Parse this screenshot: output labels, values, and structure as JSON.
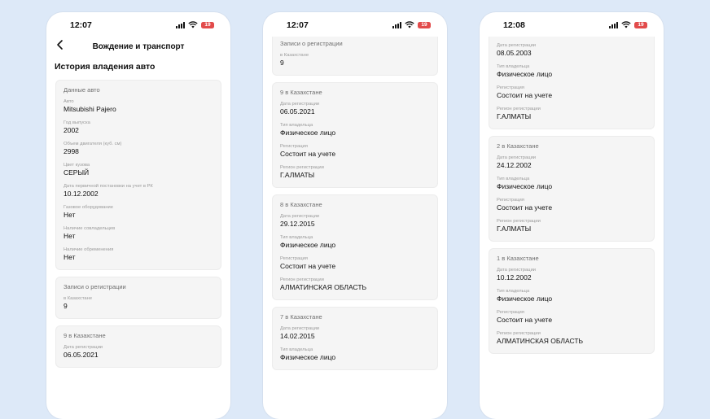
{
  "status": {
    "time1": "12:07",
    "time2": "12:07",
    "time3": "12:08",
    "battery": "19",
    "battery_color": "#e24b4b"
  },
  "icons": {
    "signal": "cellular-signal-icon",
    "wifi": "wifi-icon",
    "battery": "battery-icon",
    "back": "chevron-left-icon"
  },
  "screen1": {
    "nav_title": "Вождение и транспорт",
    "page_title": "История владения авто",
    "car_card": {
      "title": "Данные авто",
      "fields": [
        {
          "label": "Авто",
          "value": "Mitsubishi Pajero"
        },
        {
          "label": "Год выпуска",
          "value": "2002"
        },
        {
          "label": "Объем двигателя (куб. см)",
          "value": "2998"
        },
        {
          "label": "Цвет кузова",
          "value": "СЕРЫЙ"
        },
        {
          "label": "Дата первичной постановки на учет в РК",
          "value": "10.12.2002"
        },
        {
          "label": "Газовое оборудование",
          "value": "Нет"
        },
        {
          "label": "Наличие совладельцев",
          "value": "Нет"
        },
        {
          "label": "Наличие обременения",
          "value": "Нет"
        }
      ]
    },
    "records_card": {
      "title": "Записи о регистрации",
      "label": "в Казахстане",
      "value": "9"
    },
    "partial_card": {
      "title": "9 в Казахстане",
      "label": "Дата регистрации",
      "value": "06.05.2021"
    }
  },
  "screen2": {
    "records_card": {
      "title": "Записи о регистрации",
      "label": "в Казахстане",
      "value": "9"
    },
    "cards": [
      {
        "title": "9 в Казахстане",
        "fields": [
          {
            "label": "Дата регистрации",
            "value": "06.05.2021"
          },
          {
            "label": "Тип владельца",
            "value": "Физическое лицо"
          },
          {
            "label": "Регистрация",
            "value": "Состоит на учете"
          },
          {
            "label": "Регион регистрации",
            "value": "Г.АЛМАТЫ"
          }
        ]
      },
      {
        "title": "8 в Казахстане",
        "fields": [
          {
            "label": "Дата регистрации",
            "value": "29.12.2015"
          },
          {
            "label": "Тип владельца",
            "value": "Физическое лицо"
          },
          {
            "label": "Регистрация",
            "value": "Состоит на учете"
          },
          {
            "label": "Регион регистрации",
            "value": "АЛМАТИНСКАЯ ОБЛАСТЬ"
          }
        ]
      },
      {
        "title": "7 в Казахстане",
        "fields": [
          {
            "label": "Дата регистрации",
            "value": "14.02.2015"
          },
          {
            "label": "Тип владельца",
            "value": "Физическое лицо"
          }
        ]
      }
    ]
  },
  "screen3": {
    "top_card": {
      "fields": [
        {
          "label": "Дата регистрации",
          "value": "08.05.2003"
        },
        {
          "label": "Тип владельца",
          "value": "Физическое лицо"
        },
        {
          "label": "Регистрация",
          "value": "Состоит на учете"
        },
        {
          "label": "Регион регистрации",
          "value": "Г.АЛМАТЫ"
        }
      ]
    },
    "cards": [
      {
        "title": "2 в Казахстане",
        "fields": [
          {
            "label": "Дата регистрации",
            "value": "24.12.2002"
          },
          {
            "label": "Тип владельца",
            "value": "Физическое лицо"
          },
          {
            "label": "Регистрация",
            "value": "Состоит на учете"
          },
          {
            "label": "Регион регистрации",
            "value": "Г.АЛМАТЫ"
          }
        ]
      },
      {
        "title": "1 в Казахстане",
        "fields": [
          {
            "label": "Дата регистрации",
            "value": "10.12.2002"
          },
          {
            "label": "Тип владельца",
            "value": "Физическое лицо"
          },
          {
            "label": "Регистрация",
            "value": "Состоит на учете"
          },
          {
            "label": "Регион регистрации",
            "value": "АЛМАТИНСКАЯ ОБЛАСТЬ"
          }
        ]
      }
    ]
  }
}
